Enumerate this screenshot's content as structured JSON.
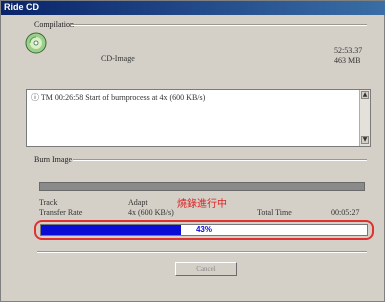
{
  "window": {
    "title": "Ride CD"
  },
  "compilation": {
    "label": "Compilation",
    "source_label": "CD-Image",
    "time": "52:53.37",
    "size": "463 MB"
  },
  "log": {
    "line": "ⓘ TM 00:26:58 Start of burnprocess at 4x (600 KB/s)"
  },
  "burn": {
    "label": "Burn Image",
    "track_label": "Track",
    "track_value": "Adapt",
    "transfer_label": "Transfer Rate",
    "transfer_value": "4x (600 KB/s)",
    "status_text": "燒錄進行中",
    "total_time_label": "Total Time",
    "total_time_value": "00:05:27",
    "progress_percent": 43,
    "progress_text": "43%"
  },
  "buttons": {
    "cancel_label": "Cancel"
  },
  "colors": {
    "progress": "#0b0bd6",
    "highlight": "#e03030",
    "status_text": "#e02020",
    "titlebar": "#0a246a"
  },
  "icons": {
    "disc": "cd-disc-icon"
  }
}
